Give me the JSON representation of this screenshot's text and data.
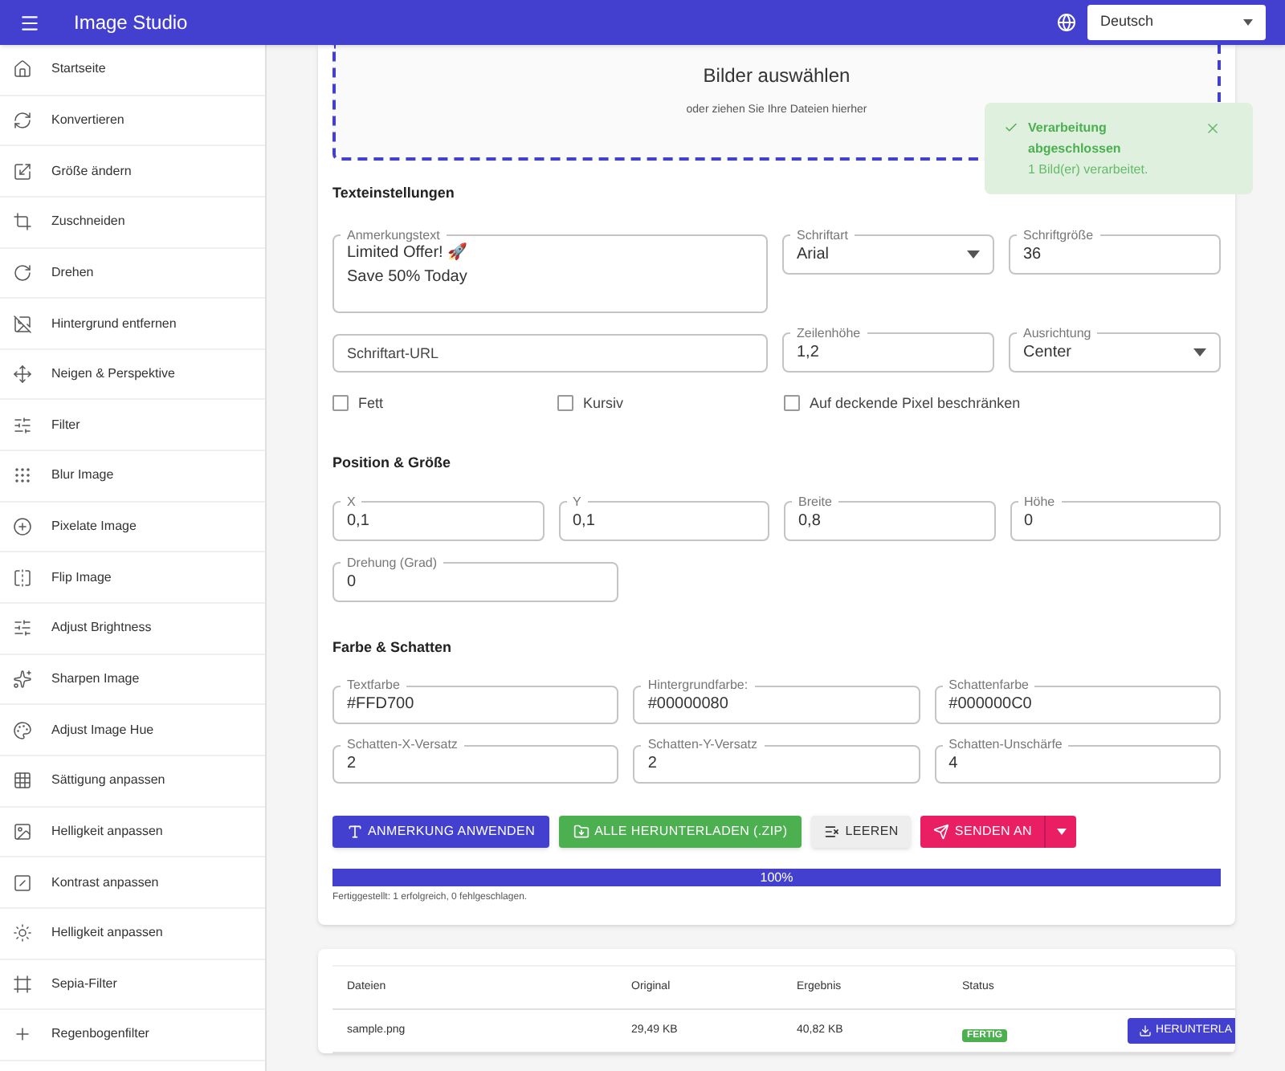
{
  "app_bar": {
    "title": "Image Studio",
    "language": "Deutsch"
  },
  "sidebar": {
    "items": [
      {
        "label": "Startseite"
      },
      {
        "label": "Konvertieren"
      },
      {
        "label": "Größe ändern"
      },
      {
        "label": "Zuschneiden"
      },
      {
        "label": "Drehen"
      },
      {
        "label": "Hintergrund entfernen"
      },
      {
        "label": "Neigen & Perspektive"
      },
      {
        "label": "Filter"
      },
      {
        "label": "Blur Image"
      },
      {
        "label": "Pixelate Image"
      },
      {
        "label": "Flip Image"
      },
      {
        "label": "Adjust Brightness"
      },
      {
        "label": "Sharpen Image"
      },
      {
        "label": "Adjust Image Hue"
      },
      {
        "label": "Sättigung anpassen"
      },
      {
        "label": "Helligkeit anpassen"
      },
      {
        "label": "Kontrast anpassen"
      },
      {
        "label": "Helligkeit anpassen"
      },
      {
        "label": "Sepia-Filter"
      },
      {
        "label": "Regenbogenfilter"
      }
    ]
  },
  "dropzone": {
    "title": "Bilder auswählen",
    "subtitle": "oder ziehen Sie Ihre Dateien hierher"
  },
  "toast": {
    "title": "Verarbeitung abgeschlossen",
    "message": "1 Bild(er) verarbeitet."
  },
  "text_settings": {
    "heading": "Texteinstellungen",
    "annotation": {
      "label": "Anmerkungstext",
      "value": "Limited Offer! 🚀\nSave 50% Today"
    },
    "font": {
      "label": "Schriftart",
      "value": "Arial"
    },
    "font_size": {
      "label": "Schriftgröße",
      "value": "36"
    },
    "font_url": {
      "placeholder": "Schriftart-URL"
    },
    "line_height": {
      "label": "Zeilenhöhe",
      "value": "1,2"
    },
    "alignment": {
      "label": "Ausrichtung",
      "value": "Center"
    },
    "checkboxes": [
      {
        "label": "Fett",
        "checked": false
      },
      {
        "label": "Kursiv",
        "checked": false
      },
      {
        "label": "Auf deckende Pixel beschränken",
        "checked": false
      }
    ]
  },
  "position_size": {
    "heading": "Position & Größe",
    "fields": [
      {
        "label": "X",
        "value": "0,1"
      },
      {
        "label": "Y",
        "value": "0,1"
      },
      {
        "label": "Breite",
        "value": "0,8"
      },
      {
        "label": "Höhe",
        "value": "0"
      }
    ],
    "rotation": {
      "label": "Drehung (Grad)",
      "value": "0"
    }
  },
  "color_shadow": {
    "heading": "Farbe & Schatten",
    "fields": [
      {
        "label": "Textfarbe",
        "value": "#FFD700"
      },
      {
        "label": "Hintergrundfarbe:",
        "value": "#00000080"
      },
      {
        "label": "Schattenfarbe",
        "value": "#000000C0"
      },
      {
        "label": "Schatten-X-Versatz",
        "value": "2"
      },
      {
        "label": "Schatten-Y-Versatz",
        "value": "2"
      },
      {
        "label": "Schatten-Unschärfe",
        "value": "4"
      }
    ]
  },
  "actions": {
    "apply": "ANMERKUNG ANWENDEN",
    "download_all": "ALLE HERUNTERLADEN (.ZIP)",
    "clear": "LEEREN",
    "send": "SENDEN AN"
  },
  "progress": {
    "level": 1,
    "label": "100%",
    "summary": "Fertiggestellt: 1 erfolgreich, 0 fehlgeschlagen."
  },
  "table": {
    "columns": [
      "Dateien",
      "Original",
      "Ergebnis",
      "Status"
    ],
    "rows": [
      {
        "file": "sample.png",
        "original": "29,49 KB",
        "result": "40,82 KB",
        "status": "FERTIG",
        "action": "HERUNTERLA"
      }
    ]
  }
}
